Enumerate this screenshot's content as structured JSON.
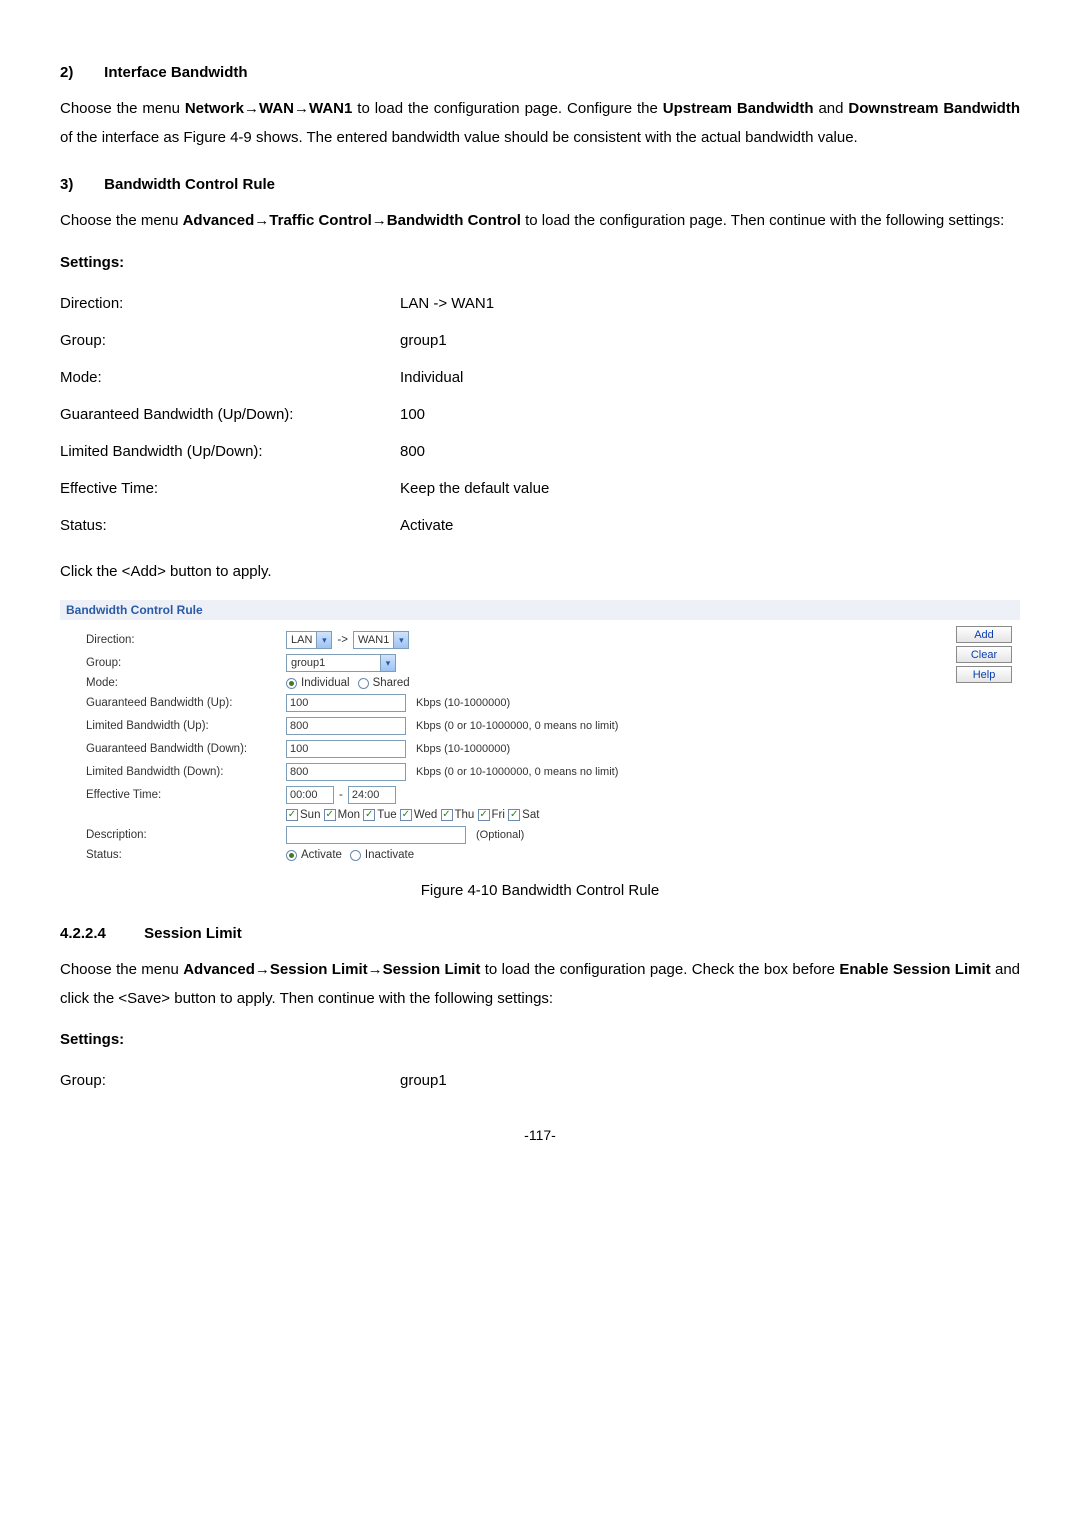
{
  "s2": {
    "heading_num": "2)",
    "heading_txt": "Interface Bandwidth",
    "para_a": "Choose the menu ",
    "nav": "Network→WAN→WAN1",
    "para_b": " to load the configuration page. Configure the ",
    "u1": "Upstream Bandwidth",
    "para_c": " and ",
    "u2": "Downstream Bandwidth",
    "para_d": " of the interface as Figure 4-9 shows. The entered bandwidth value should be consistent with the actual bandwidth value."
  },
  "s3": {
    "heading_num": "3)",
    "heading_txt": "Bandwidth Control Rule",
    "para_a": "Choose the menu ",
    "nav": "Advanced→Traffic Control→Bandwidth Control",
    "para_b": " to load the configuration page. Then continue with the following settings:"
  },
  "settings_label": "Settings:",
  "settings_rows": [
    {
      "k": "Direction:",
      "v": "LAN -> WAN1"
    },
    {
      "k": "Group:",
      "v": "group1"
    },
    {
      "k": "Mode:",
      "v": "Individual"
    },
    {
      "k": "Guaranteed Bandwidth (Up/Down):",
      "v": "100"
    },
    {
      "k": "Limited Bandwidth (Up/Down):",
      "v": "800"
    },
    {
      "k": "Effective Time:",
      "v": "Keep the default value"
    },
    {
      "k": "Status:",
      "v": "Activate"
    }
  ],
  "click_add": "Click the <Add> button to apply.",
  "panel": {
    "title": "Bandwidth Control Rule",
    "labels": {
      "direction": "Direction:",
      "group": "Group:",
      "mode": "Mode:",
      "gbw_up": "Guaranteed Bandwidth (Up):",
      "lbw_up": "Limited Bandwidth (Up):",
      "gbw_dn": "Guaranteed Bandwidth (Down):",
      "lbw_dn": "Limited Bandwidth (Down):",
      "eff": "Effective Time:",
      "desc": "Description:",
      "status": "Status:"
    },
    "direction_from": "LAN",
    "direction_arrow": "->",
    "direction_to": "WAN1",
    "group_val": "group1",
    "mode_individual": "Individual",
    "mode_shared": "Shared",
    "gbw_up_val": "100",
    "gbw_up_hint": "Kbps (10-1000000)",
    "lbw_up_val": "800",
    "lbw_up_hint": "Kbps (0 or 10-1000000, 0 means no limit)",
    "gbw_dn_val": "100",
    "gbw_dn_hint": "Kbps (10-1000000)",
    "lbw_dn_val": "800",
    "lbw_dn_hint": "Kbps (0 or 10-1000000, 0 means no limit)",
    "eff_from": "00:00",
    "eff_dash": "-",
    "eff_to": "24:00",
    "days": [
      "Sun",
      "Mon",
      "Tue",
      "Wed",
      "Thu",
      "Fri",
      "Sat"
    ],
    "desc_hint": "(Optional)",
    "status_activate": "Activate",
    "status_inactivate": "Inactivate",
    "btn_add": "Add",
    "btn_clear": "Clear",
    "btn_help": "Help"
  },
  "fig_caption": "Figure 4-10 Bandwidth Control Rule",
  "s4224": {
    "num": "4.2.2.4",
    "title": "Session Limit",
    "para_a": "Choose the menu ",
    "nav": "Advanced→Session Limit→Session Limit",
    "para_b": " to load the configuration page. Check the box before ",
    "b1": "Enable Session Limit",
    "para_c": " and click the <Save> button to apply. Then continue with the following settings:"
  },
  "settings2": {
    "label": "Settings:",
    "row_k": "Group:",
    "row_v": "group1"
  },
  "page_num": "-117-"
}
